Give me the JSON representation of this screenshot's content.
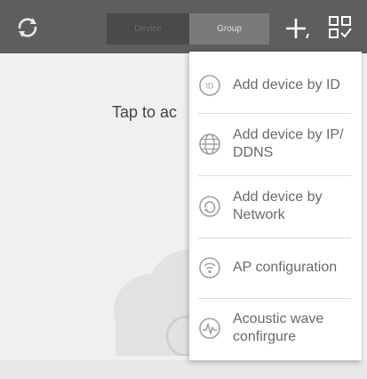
{
  "topbar": {
    "segments": {
      "device_label": "Device",
      "group_label": "Group"
    },
    "selected_segment": "group"
  },
  "main": {
    "hint_text": "Tap to ac"
  },
  "add_menu": {
    "items": [
      {
        "label": "Add device by ID",
        "icon": "id-icon"
      },
      {
        "label": "Add device by IP/ DDNS",
        "icon": "globe-icon"
      },
      {
        "label": "Add device by Network",
        "icon": "network-icon"
      },
      {
        "label": "AP configuration",
        "icon": "wifi-icon"
      },
      {
        "label": "Acoustic wave confirgure",
        "icon": "sound-wave-icon"
      }
    ]
  },
  "colors": {
    "topbar": "#5e5e5e",
    "segment_selected": "#7a7a7a",
    "segment_unselected": "#4a4a4a",
    "menu_text": "#6a6a6a",
    "icon_gray": "#9a9a9a"
  }
}
